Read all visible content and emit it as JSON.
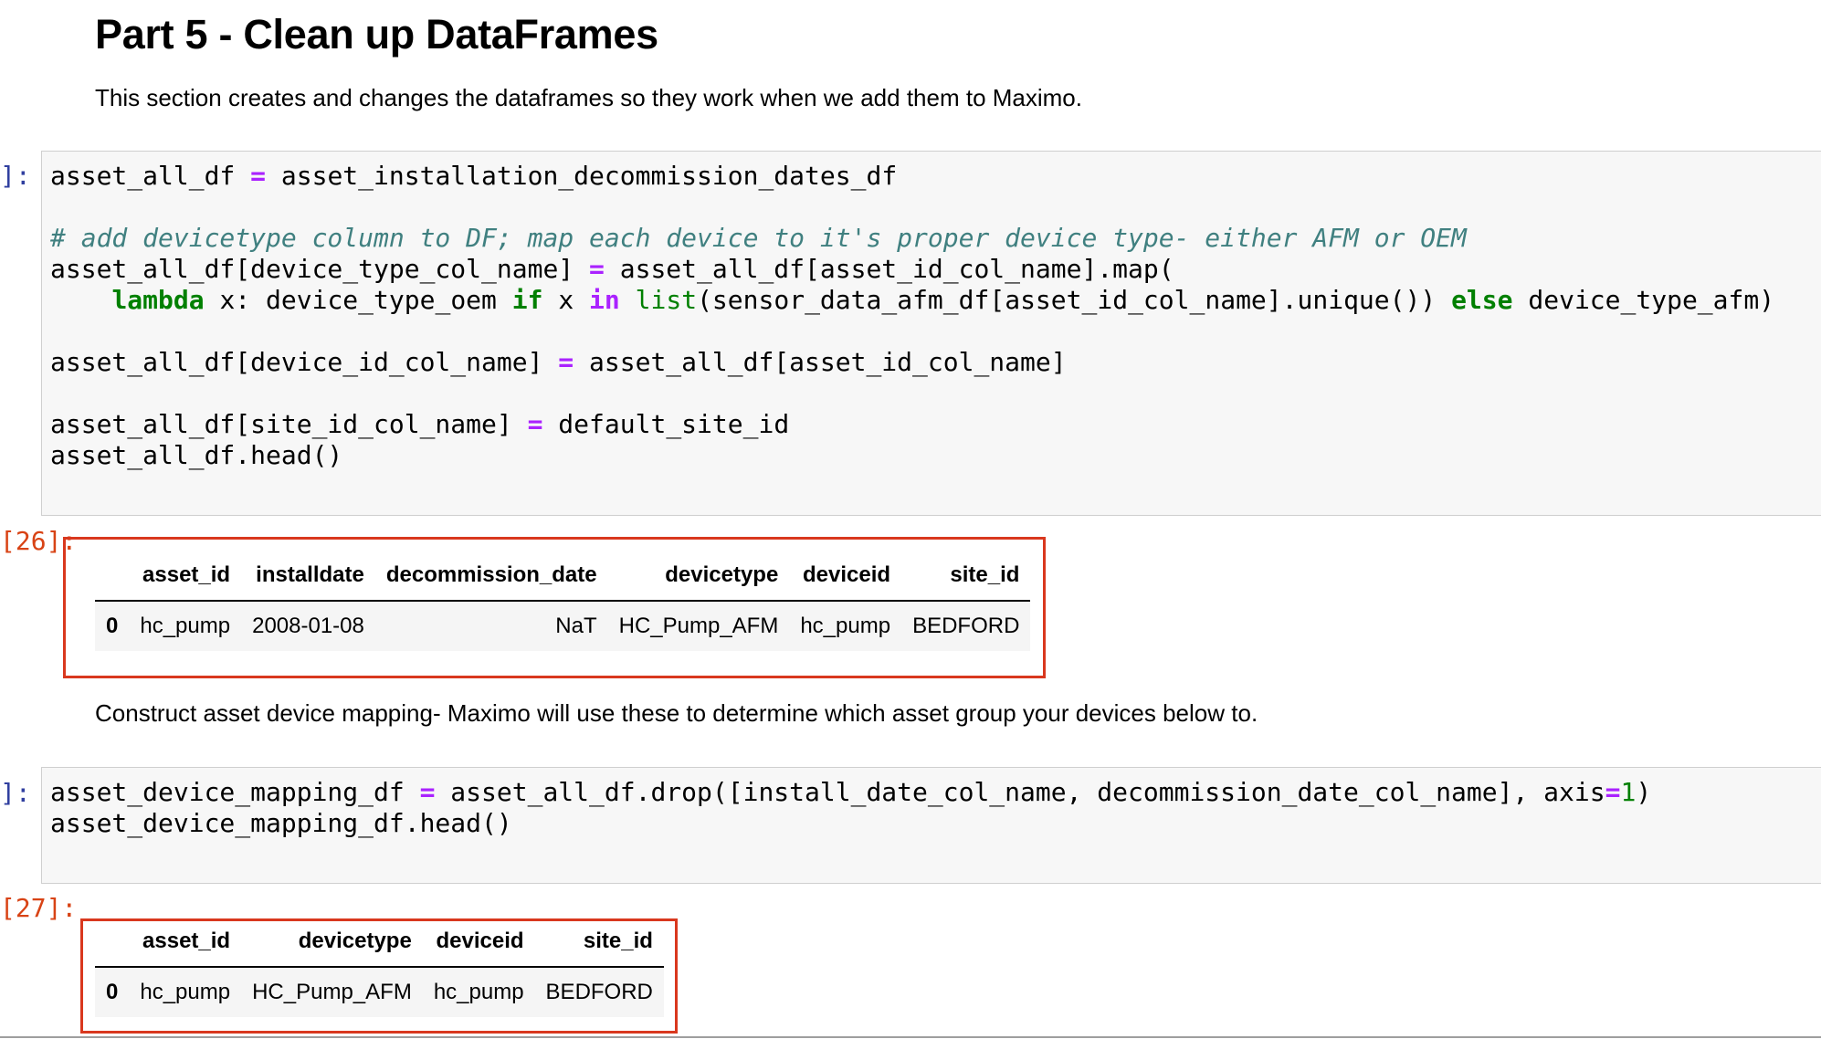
{
  "heading": "Part 5 - Clean up DataFrames",
  "intro": "This section creates and changes the dataframes so they work when we add them to Maximo.",
  "cell1": {
    "in_prompt": "]:",
    "out_prompt": "[26]:",
    "table": {
      "headers": [
        "",
        "asset_id",
        "installdate",
        "decommission_date",
        "devicetype",
        "deviceid",
        "site_id"
      ],
      "rows": [
        [
          "0",
          "hc_pump",
          "2008-01-08",
          "NaT",
          "HC_Pump_AFM",
          "hc_pump",
          "BEDFORD"
        ]
      ]
    }
  },
  "para2": "Construct asset device mapping- Maximo will use these to determine which asset group your devices below to.",
  "cell2": {
    "in_prompt": "]:",
    "out_prompt": "[27]:",
    "table": {
      "headers": [
        "",
        "asset_id",
        "devicetype",
        "deviceid",
        "site_id"
      ],
      "rows": [
        [
          "0",
          "hc_pump",
          "HC_Pump_AFM",
          "hc_pump",
          "BEDFORD"
        ]
      ]
    }
  }
}
